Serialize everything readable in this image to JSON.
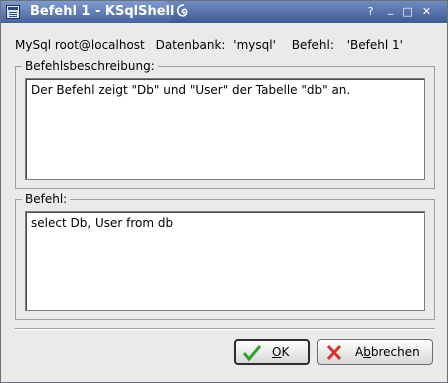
{
  "window": {
    "title": "Befehl 1 - KSqlShell",
    "controls": [
      "?",
      "_",
      "□",
      "✕"
    ]
  },
  "info": {
    "connection": "MySql root@localhost",
    "database_label": "Datenbank:",
    "database_value": "'mysql'",
    "command_label": "Befehl:",
    "command_value": "'Befehl 1'"
  },
  "description_group": {
    "title": "Befehlsbeschreibung:",
    "text": "Der Befehl zeigt \"Db\" und \"User\" der Tabelle \"db\" an."
  },
  "command_group": {
    "title": "Befehl:",
    "text": "select Db, User from db"
  },
  "buttons": {
    "ok_pre": "",
    "ok_underline": "O",
    "ok_post": "K",
    "cancel_pre": "A",
    "cancel_underline": "b",
    "cancel_post": "brechen"
  },
  "colors": {
    "titlebar": "#3e5a94",
    "ok_icon": "#2ea12e",
    "cancel_icon": "#d93030"
  },
  "icons": {
    "app": "ksqlshell-app-icon",
    "titlebar_decoration": "swirl-icon",
    "ok": "checkmark-icon",
    "cancel": "x-cross-icon"
  }
}
